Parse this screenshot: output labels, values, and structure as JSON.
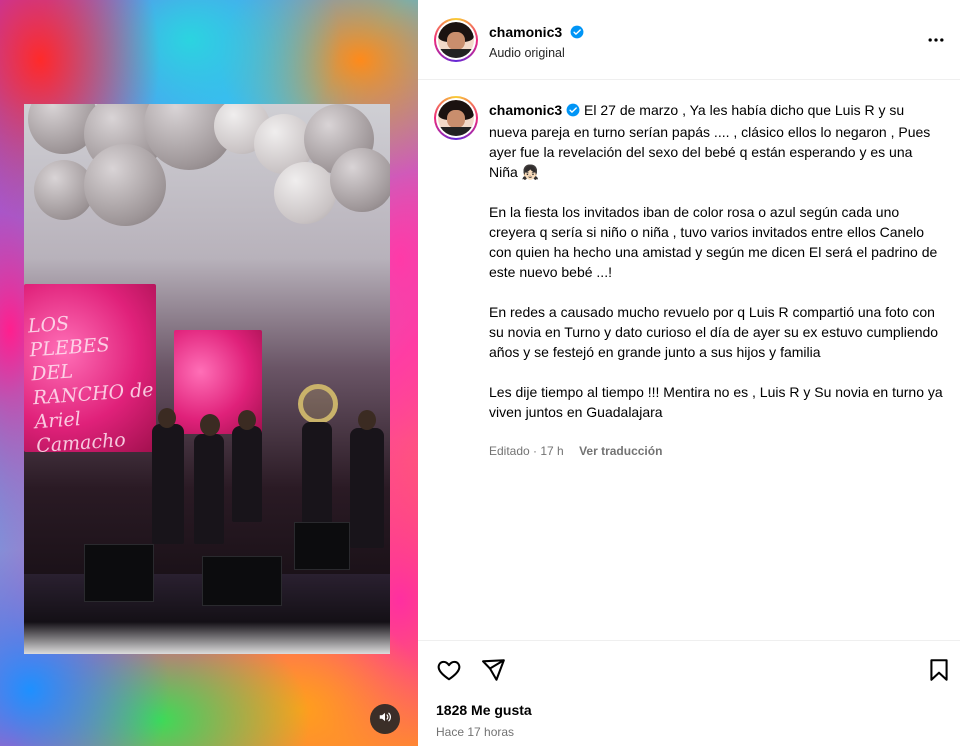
{
  "post": {
    "username": "chamonic3",
    "audio_label": "Audio original",
    "caption_paragraphs": [
      "El 27 de marzo , Ya les había dicho que Luis R y su nueva pareja en turno serían papás .... , clásico ellos lo negaron , Pues ayer fue la revelación del sexo del bebé q están esperando y es una Niña 👧🏻",
      "En la fiesta los invitados iban de color rosa o azul según cada uno creyera q sería si niño o niña , tuvo varios invitados entre ellos Canelo con quien ha hecho una amistad y según me dicen El será el padrino de este nuevo bebé ...!",
      "En redes a causado mucho revuelo por q Luis R compartió una foto con su novia en Turno y dato curioso el día de ayer su ex estuvo cumpliendo años y se festejó en grande junto a sus hijos y familia",
      "Les dije tiempo al tiempo !!! Mentira no es , Luis R y Su novia en turno ya viven juntos en Guadalajara"
    ],
    "edited_label": "Editado · 17 h",
    "translate_label": "Ver traducción",
    "likes_label": "1828 Me gusta",
    "posted_label": "Hace 17 horas"
  },
  "media": {
    "stage_screen_text": "LOS PLEBES DEL RANCHO de Ariel Camacho"
  },
  "colors": {
    "verified": "#0095f6",
    "secondary_text": "#737373"
  },
  "icons": {
    "more": "more-horizontal-icon",
    "like": "heart-icon",
    "share": "paper-plane-icon",
    "save": "bookmark-icon",
    "mute": "speaker-icon"
  }
}
